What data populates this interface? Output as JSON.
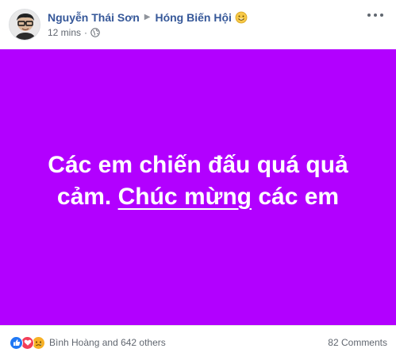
{
  "post": {
    "author": "Nguyễn Thái Sơn",
    "group": "Hóng Biến Hội",
    "timestamp": "12 mins",
    "separator": "·",
    "status_text_line1": "Các em chiến đấu quá quả",
    "status_text_line2_pre": "cảm. ",
    "status_text_link": "Chúc mừng",
    "status_text_line2_post": " các em",
    "status_background": "#b200ff",
    "reactions_summary": "Bình Hoàng and 642 others",
    "comments_count": "82 Comments",
    "reaction_icons": [
      "like-icon",
      "love-icon",
      "sad-icon"
    ]
  }
}
